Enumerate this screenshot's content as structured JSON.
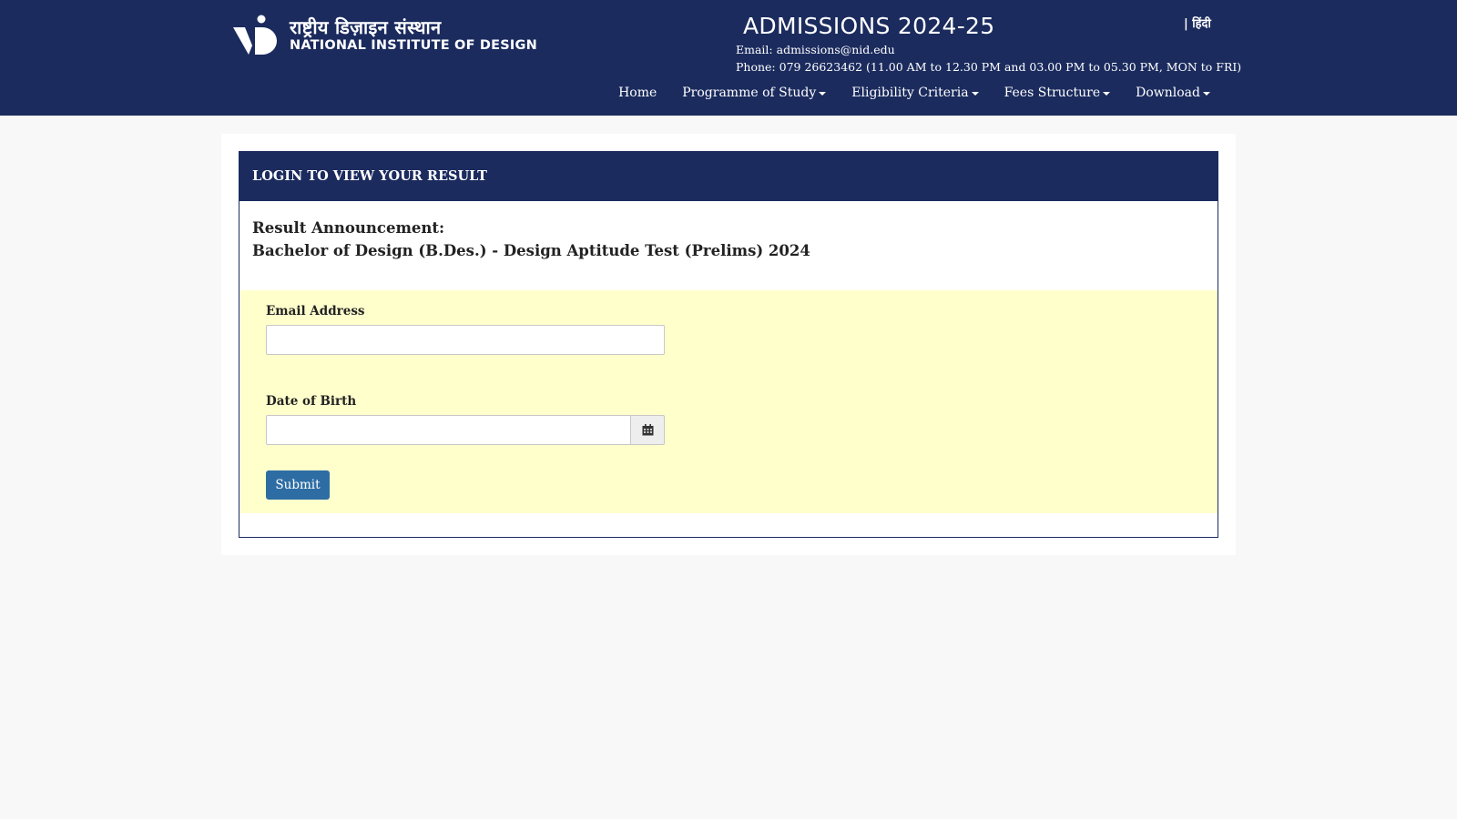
{
  "header": {
    "logo_hindi": "राष्ट्रीय डिज़ाइन संस्थान",
    "logo_english": "NATIONAL INSTITUTE OF DESIGN",
    "admissions_title": "ADMISSIONS 2024-25",
    "language_toggle": "| हिंदी",
    "email_line": "Email: admissions@nid.edu",
    "phone_line": "Phone: 079 26623462 (11.00 AM to 12.30 PM and 03.00 PM to 05.30 PM, MON to FRI)"
  },
  "nav": [
    {
      "label": "Home",
      "dropdown": false
    },
    {
      "label": "Programme of Study",
      "dropdown": true
    },
    {
      "label": "Eligibility Criteria",
      "dropdown": true
    },
    {
      "label": "Fees Structure",
      "dropdown": true
    },
    {
      "label": "Download",
      "dropdown": true
    }
  ],
  "card": {
    "header": "LOGIN TO VIEW YOUR RESULT",
    "announce_line1": "Result Announcement:",
    "announce_line2": "Bachelor of Design (B.Des.) - Design Aptitude Test (Prelims) 2024"
  },
  "form": {
    "email_label": "Email Address",
    "email_value": "",
    "dob_label": "Date of Birth",
    "dob_value": "",
    "calendar_icon": "calendar-icon",
    "submit_label": "Submit"
  },
  "colors": {
    "header_bg": "#1b2b5e",
    "form_bg": "#ffffcc",
    "submit_bg": "#2e6da4",
    "page_bg": "#f8f8f8"
  }
}
